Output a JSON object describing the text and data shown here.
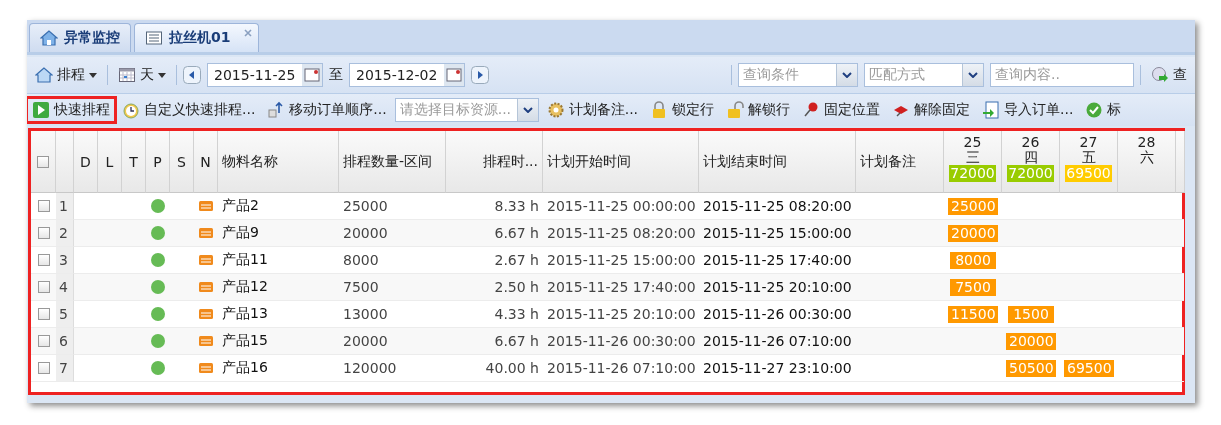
{
  "tabs": [
    {
      "kind": "home",
      "label": "异常监控",
      "selected": false,
      "closable": false
    },
    {
      "kind": "list",
      "label": "拉丝机01",
      "selected": true,
      "closable": true
    }
  ],
  "toolbar": {
    "schedule_menu": "排程",
    "view_menu": "天",
    "start_date": "2015-11-25",
    "range_label": "至",
    "end_date": "2015-12-02",
    "query_condition": {
      "placeholder": "查询条件"
    },
    "match_mode": {
      "placeholder": "匹配方式"
    },
    "query_content": {
      "placeholder": "查询内容.."
    },
    "query_button": "查"
  },
  "actions": [
    {
      "kind": "play",
      "label": "快速排程",
      "highlighted": true
    },
    {
      "kind": "clock",
      "label": "自定义快速排程...",
      "highlighted": false
    },
    {
      "kind": "move",
      "label": "移动订单顺序...",
      "highlighted": false
    },
    {
      "kind": "select",
      "placeholder": "请选择目标资源...",
      "highlighted": false
    },
    {
      "kind": "gear",
      "label": "计划备注...",
      "highlighted": false
    },
    {
      "kind": "lock",
      "label": "锁定行",
      "highlighted": false
    },
    {
      "kind": "unlock",
      "label": "解锁行",
      "highlighted": false
    },
    {
      "kind": "pin",
      "label": "固定位置",
      "highlighted": false
    },
    {
      "kind": "unpin",
      "label": "解除固定",
      "highlighted": false
    },
    {
      "kind": "import",
      "label": "导入订单...",
      "highlighted": false
    },
    {
      "kind": "check",
      "label": "标",
      "highlighted": false
    }
  ],
  "grid": {
    "highlighted": true,
    "all_checked": false,
    "columns": [
      "D",
      "L",
      "T",
      "P",
      "S",
      "N",
      "物料名称",
      "排程数量-区间",
      "排程时...",
      "计划开始时间",
      "计划结束时间",
      "计划备注"
    ],
    "days": [
      {
        "day": "25",
        "weekday": "三",
        "total": "72000",
        "color": "#99cc00"
      },
      {
        "day": "26",
        "weekday": "四",
        "total": "72000",
        "color": "#99cc00"
      },
      {
        "day": "27",
        "weekday": "五",
        "total": "69500",
        "color": "#ffcc00"
      },
      {
        "day": "28",
        "weekday": "六"
      }
    ],
    "rows": [
      {
        "number": "1",
        "checked": false,
        "color": "#66bb55",
        "material": "产品2",
        "quantity": "25000",
        "duration": "8.33 h",
        "start": "2015-11-25 00:00:00",
        "end": "2015-11-25 08:20:00",
        "daily": [
          {
            "filled": true,
            "quantity": "25000"
          },
          {
            "filled": false
          },
          {
            "filled": false
          },
          {
            "filled": false
          }
        ]
      },
      {
        "number": "2",
        "checked": false,
        "color": "#66bb55",
        "material": "产品9",
        "quantity": "20000",
        "duration": "6.67 h",
        "start": "2015-11-25 08:20:00",
        "end": "2015-11-25 15:00:00",
        "daily": [
          {
            "filled": true,
            "quantity": "20000"
          },
          {
            "filled": false
          },
          {
            "filled": false
          },
          {
            "filled": false
          }
        ]
      },
      {
        "number": "3",
        "checked": false,
        "color": "#66bb55",
        "material": "产品11",
        "quantity": "8000",
        "duration": "2.67 h",
        "start": "2015-11-25 15:00:00",
        "end": "2015-11-25 17:40:00",
        "daily": [
          {
            "filled": true,
            "quantity": "8000"
          },
          {
            "filled": false
          },
          {
            "filled": false
          },
          {
            "filled": false
          }
        ]
      },
      {
        "number": "4",
        "checked": false,
        "color": "#66bb55",
        "material": "产品12",
        "quantity": "7500",
        "duration": "2.50 h",
        "start": "2015-11-25 17:40:00",
        "end": "2015-11-25 20:10:00",
        "daily": [
          {
            "filled": true,
            "quantity": "7500"
          },
          {
            "filled": false
          },
          {
            "filled": false
          },
          {
            "filled": false
          }
        ]
      },
      {
        "number": "5",
        "checked": false,
        "color": "#66bb55",
        "material": "产品13",
        "quantity": "13000",
        "duration": "4.33 h",
        "start": "2015-11-25 20:10:00",
        "end": "2015-11-26 00:30:00",
        "daily": [
          {
            "filled": true,
            "quantity": "11500"
          },
          {
            "filled": true,
            "quantity": "1500"
          },
          {
            "filled": false
          },
          {
            "filled": false
          }
        ]
      },
      {
        "number": "6",
        "checked": false,
        "color": "#66bb55",
        "material": "产品15",
        "quantity": "20000",
        "duration": "6.67 h",
        "start": "2015-11-26 00:30:00",
        "end": "2015-11-26 07:10:00",
        "daily": [
          {
            "filled": false
          },
          {
            "filled": true,
            "quantity": "20000"
          },
          {
            "filled": false
          },
          {
            "filled": false
          }
        ]
      },
      {
        "number": "7",
        "checked": false,
        "color": "#66bb55",
        "material": "产品16",
        "quantity": "120000",
        "duration": "40.00 h",
        "start": "2015-11-26 07:10:00",
        "end": "2015-11-27 23:10:00",
        "daily": [
          {
            "filled": false
          },
          {
            "filled": true,
            "quantity": "50500"
          },
          {
            "filled": true,
            "quantity": "69500"
          },
          {
            "filled": false
          }
        ]
      }
    ]
  }
}
